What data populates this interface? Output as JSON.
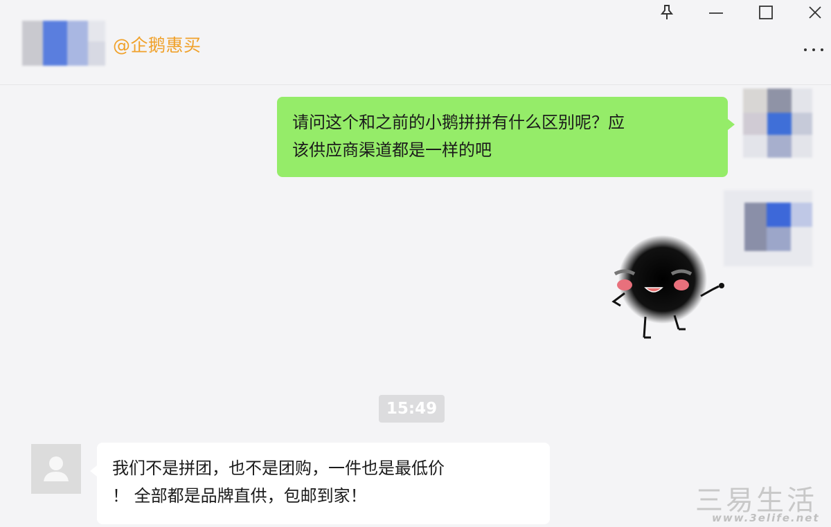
{
  "header": {
    "contact_name": "@企鹅惠买"
  },
  "window_controls": {
    "pin_icon": "pin-icon",
    "minimize_icon": "minimize-icon",
    "maximize_icon": "maximize-icon",
    "close_icon": "close-icon",
    "more_icon": "more-icon"
  },
  "messages": [
    {
      "sender": "self",
      "lines": [
        "请问这个和之前的小鹅拼拼有什么区别呢？应",
        "该供应商渠道都是一样的吧"
      ]
    },
    {
      "sender": "self",
      "type": "sticker",
      "sticker": "black-fuzzball-sticker"
    },
    {
      "type": "timestamp",
      "text": "15:49"
    },
    {
      "sender": "other",
      "lines": [
        "我们不是拼团，也不是团购，一件也是最低价",
        "！ 全部都是品牌直供，包邮到家！"
      ]
    }
  ],
  "watermark": {
    "text": "三易生活",
    "url": "www.3elife.net"
  },
  "colors": {
    "contact_name": "#f0a12a",
    "self_bubble": "#95ec69",
    "other_bubble": "#ffffff",
    "background": "#f4f4f6"
  }
}
